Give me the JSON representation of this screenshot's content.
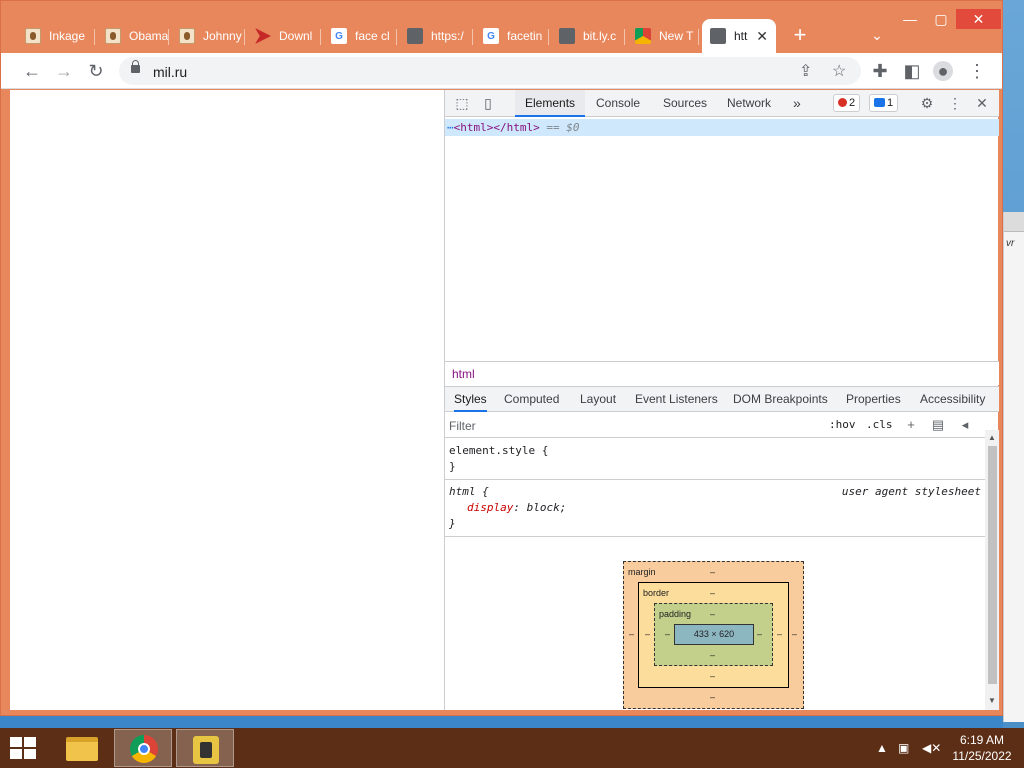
{
  "tabs": [
    {
      "label": "Inkage",
      "icon": "face"
    },
    {
      "label": "Obama",
      "icon": "face"
    },
    {
      "label": "Johnny",
      "icon": "face"
    },
    {
      "label": "Downl",
      "icon": "red-arrow"
    },
    {
      "label": "face cl",
      "icon": "google"
    },
    {
      "label": "https:/",
      "icon": "globe"
    },
    {
      "label": "facetin",
      "icon": "google"
    },
    {
      "label": "bit.ly.c",
      "icon": "globe"
    },
    {
      "label": "New T",
      "icon": "chrome"
    },
    {
      "label": "htt",
      "icon": "globe",
      "active": true
    }
  ],
  "toolbar": {
    "url": "mil.ru"
  },
  "devtools": {
    "tabs": [
      "Elements",
      "Console",
      "Sources",
      "Network"
    ],
    "more": "»",
    "errors_count": "2",
    "messages_count": "1",
    "dom_line": {
      "ellipsis": "⋯",
      "tag": "<html></html>",
      "suffix": " == $0"
    },
    "breadcrumb": "html",
    "sub_tabs": [
      "Styles",
      "Computed",
      "Layout",
      "Event Listeners",
      "DOM Breakpoints",
      "Properties",
      "Accessibility"
    ],
    "filter": {
      "placeholder": "Filter",
      "hov": ":hov",
      "cls": ".cls"
    },
    "styles": {
      "element_style": "element.style {",
      "close_brace": "}",
      "html_selector": "html {",
      "source": "user agent stylesheet",
      "prop_name": "display",
      "prop_value": "block;"
    },
    "box_model": {
      "margin_label": "margin",
      "border_label": "border",
      "padding_label": "padding",
      "content_size": "433 × 620",
      "dash": "–"
    }
  },
  "taskbar": {
    "time": "6:19 AM",
    "date": "11/25/2022"
  },
  "background_window": {
    "fragment": "vr"
  }
}
